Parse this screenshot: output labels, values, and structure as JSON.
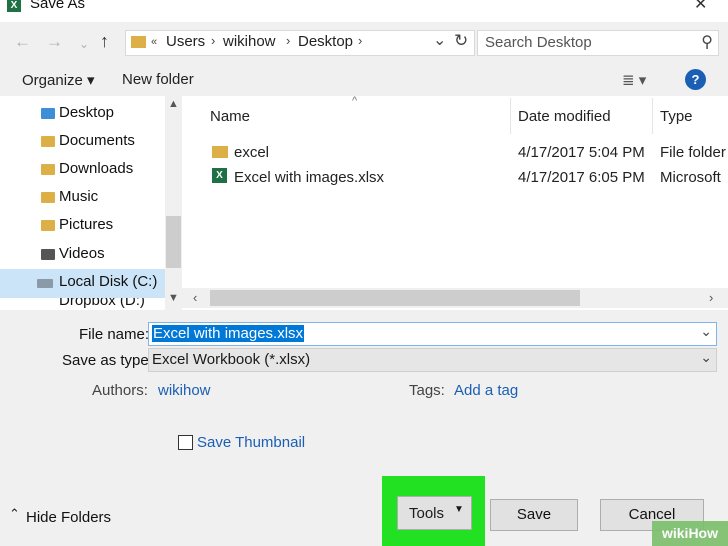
{
  "window": {
    "title": "Save As",
    "app_badge": "X",
    "close_glyph": "✕"
  },
  "address": {
    "crumbs": [
      "Users",
      "wikihow",
      "Desktop"
    ],
    "search_placeholder": "Search Desktop"
  },
  "toolbar": {
    "organize": "Organize ▾",
    "new_folder": "New folder",
    "view_glyph": "≣ ▾",
    "help": "?"
  },
  "nav": {
    "items": [
      {
        "label": "Desktop"
      },
      {
        "label": "Documents"
      },
      {
        "label": "Downloads"
      },
      {
        "label": "Music"
      },
      {
        "label": "Pictures"
      },
      {
        "label": "Videos"
      },
      {
        "label": "Local Disk (C:)"
      },
      {
        "label": "Dropbox (D:)"
      }
    ]
  },
  "files": {
    "columns": {
      "name": "Name",
      "date": "Date modified",
      "type": "Type"
    },
    "rows": [
      {
        "name": "excel",
        "date": "4/17/2017 5:04 PM",
        "type": "File folder"
      },
      {
        "name": "Excel with images.xlsx",
        "date": "4/17/2017 6:05 PM",
        "type": "Microsoft"
      }
    ]
  },
  "form": {
    "file_name_label": "File name:",
    "file_name_value": "Excel with images.xlsx",
    "save_as_type_label": "Save as type:",
    "save_as_type_value": "Excel Workbook (*.xlsx)",
    "authors_label": "Authors:",
    "authors_value": "wikihow",
    "tags_label": "Tags:",
    "tags_value": "Add a tag",
    "thumbnail_label": "Save Thumbnail"
  },
  "footer": {
    "hide_folders": "Hide Folders",
    "tools": "Tools",
    "save": "Save",
    "cancel": "Cancel",
    "watermark": "wikiHow"
  },
  "colors": {
    "highlight": "#22e022",
    "selection": "#0078d7",
    "help": "#1a5fb4"
  }
}
